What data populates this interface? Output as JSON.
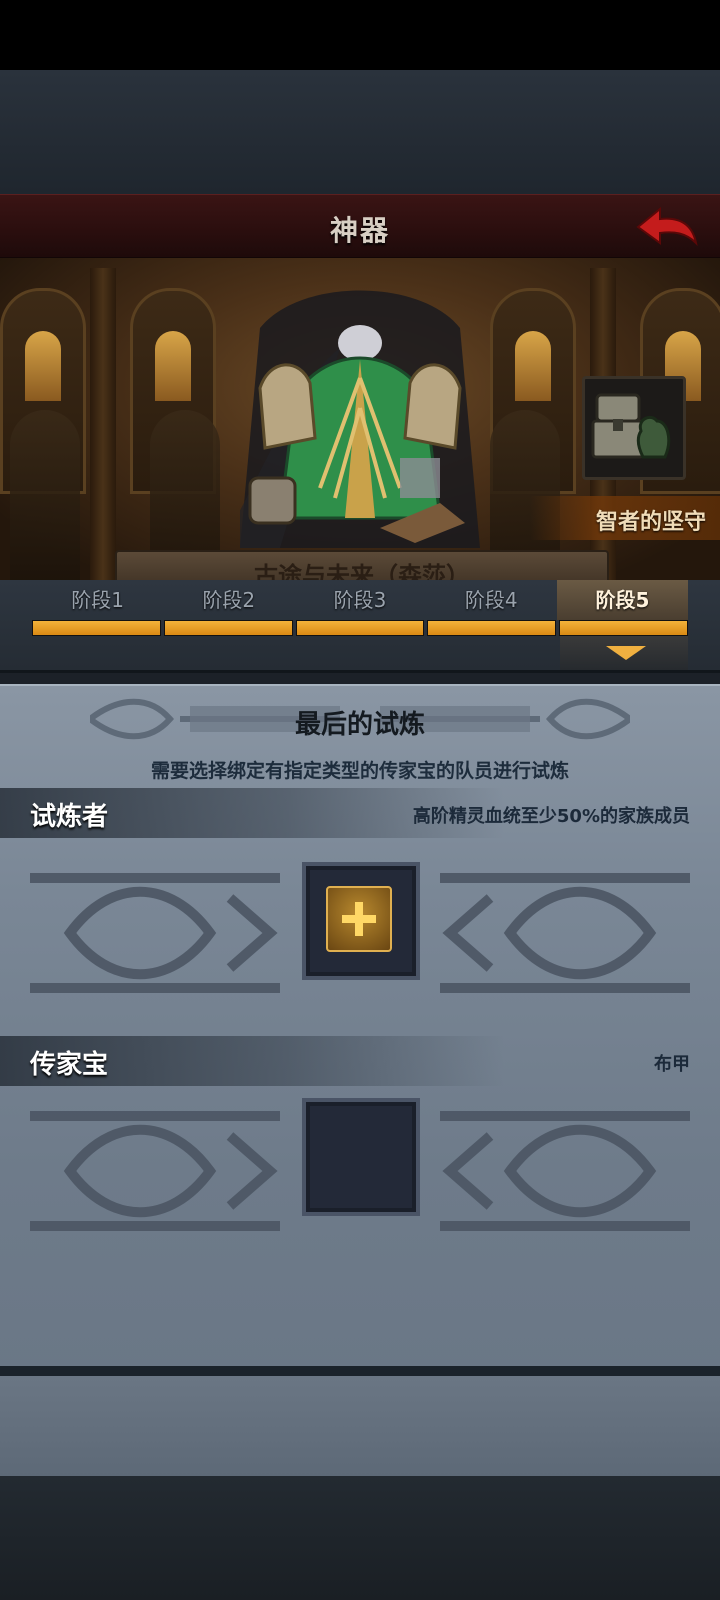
{
  "header": {
    "title": "神器"
  },
  "banner": {
    "label": "智者的坚守",
    "name_plate": "古途与未来（森莎）"
  },
  "stages": {
    "tabs": [
      "阶段1",
      "阶段2",
      "阶段3",
      "阶段4",
      "阶段5"
    ],
    "active_index": 4
  },
  "trial": {
    "title": "最后的试炼",
    "instruction": "需要选择绑定有指定类型的传家宝的队员进行试炼",
    "challenger": {
      "label": "试炼者",
      "requirement": "高阶精灵血统至少50%的家族成员"
    },
    "heirloom": {
      "label": "传家宝",
      "requirement": "布甲"
    }
  },
  "colors": {
    "accent": "#e89a20",
    "header_red": "#3a1414",
    "panel": "#7a8796"
  },
  "icons": {
    "back": "back-arrow-icon",
    "chest": "treasure-chest-icon",
    "add": "plus-icon"
  }
}
